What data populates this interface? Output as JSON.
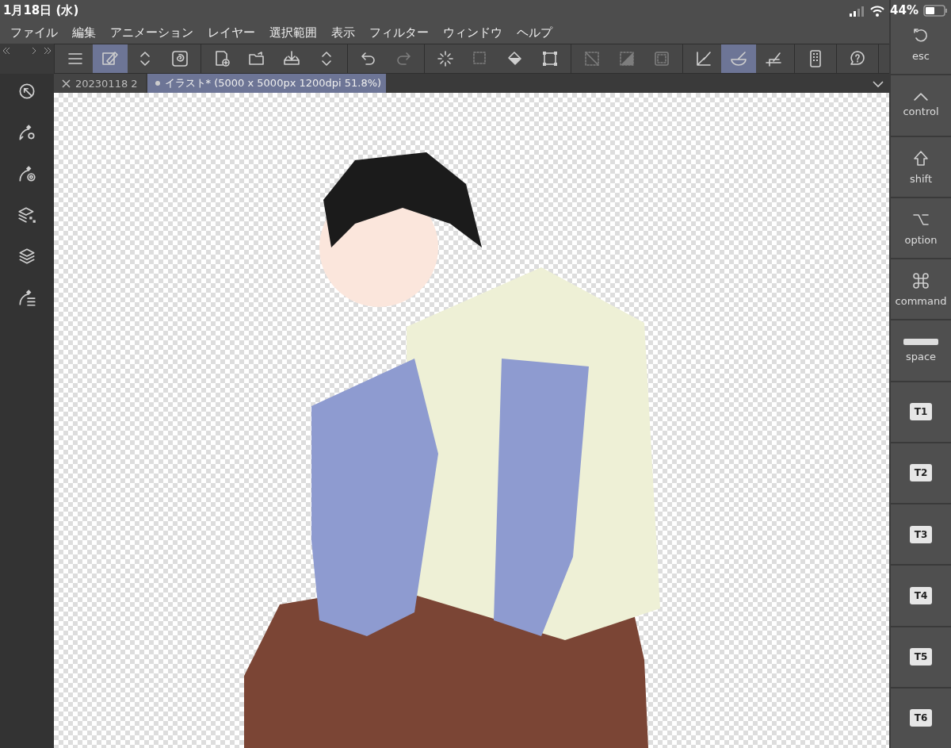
{
  "status_bar": {
    "date": "1月18日 (水)",
    "battery": "44%"
  },
  "menu": [
    "ファイル",
    "編集",
    "アニメーション",
    "レイヤー",
    "選択範囲",
    "表示",
    "フィルター",
    "ウィンドウ",
    "ヘルプ"
  ],
  "toolbar": [
    [
      {
        "kind": "menu",
        "selected": false,
        "disabled": false
      },
      {
        "kind": "edit",
        "selected": true,
        "disabled": false
      },
      {
        "kind": "updown",
        "selected": false,
        "disabled": false
      },
      {
        "kind": "swirl",
        "selected": false,
        "disabled": false
      }
    ],
    [
      {
        "kind": "new",
        "selected": false,
        "disabled": false
      },
      {
        "kind": "open",
        "selected": false,
        "disabled": false
      },
      {
        "kind": "save",
        "selected": false,
        "disabled": false
      },
      {
        "kind": "updown",
        "selected": false,
        "disabled": false
      }
    ],
    [
      {
        "kind": "undo",
        "selected": false,
        "disabled": false
      },
      {
        "kind": "redo",
        "selected": false,
        "disabled": true
      }
    ],
    [
      {
        "kind": "spinner",
        "selected": false,
        "disabled": false
      },
      {
        "kind": "dissolve",
        "selected": false,
        "disabled": true
      },
      {
        "kind": "fill",
        "selected": false,
        "disabled": false
      },
      {
        "kind": "transform",
        "selected": false,
        "disabled": false
      }
    ],
    [
      {
        "kind": "deselect",
        "selected": false,
        "disabled": true
      },
      {
        "kind": "invert",
        "selected": false,
        "disabled": true
      },
      {
        "kind": "border",
        "selected": false,
        "disabled": true
      }
    ],
    [
      {
        "kind": "ruler",
        "selected": false,
        "disabled": false
      },
      {
        "kind": "bowl",
        "selected": true,
        "disabled": false
      },
      {
        "kind": "grid",
        "selected": false,
        "disabled": false
      }
    ],
    [
      {
        "kind": "device",
        "selected": false,
        "disabled": false
      }
    ],
    [
      {
        "kind": "help",
        "selected": false,
        "disabled": false
      }
    ]
  ],
  "tabs": [
    {
      "label": "20230118 2",
      "selected": false
    },
    {
      "label": "イラスト* (5000 x 5000px 1200dpi 51.8%)",
      "selected": true
    }
  ],
  "left_rail": [
    {
      "kind": "navigator"
    },
    {
      "kind": "tool-settings"
    },
    {
      "kind": "tool-target"
    },
    {
      "kind": "layer-props"
    },
    {
      "kind": "layers"
    },
    {
      "kind": "sub-tools"
    }
  ],
  "edge_keys": [
    {
      "label": "esc",
      "kind": "esc"
    },
    {
      "label": "control",
      "kind": "control"
    },
    {
      "label": "shift",
      "kind": "shift"
    },
    {
      "label": "option",
      "kind": "option"
    },
    {
      "label": "command",
      "kind": "command"
    },
    {
      "label": "space",
      "kind": "space"
    },
    {
      "label": "T1",
      "kind": "tile"
    },
    {
      "label": "T2",
      "kind": "tile"
    },
    {
      "label": "T3",
      "kind": "tile"
    },
    {
      "label": "T4",
      "kind": "tile"
    },
    {
      "label": "T5",
      "kind": "tile"
    },
    {
      "label": "T6",
      "kind": "tile"
    }
  ]
}
